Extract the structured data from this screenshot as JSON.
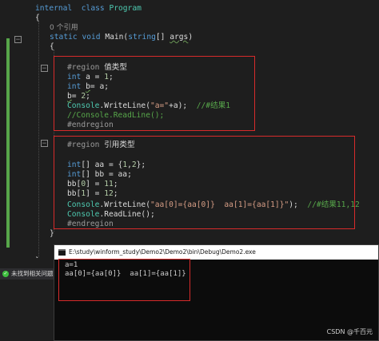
{
  "editor": {
    "lines": [
      {
        "segments": [
          [
            "kw",
            "internal"
          ],
          [
            "",
            "  "
          ],
          [
            "kw",
            "class"
          ],
          [
            "",
            ""
          ],
          [
            "ty",
            " Program"
          ]
        ]
      },
      {
        "segments": [
          [
            "",
            "{"
          ]
        ]
      },
      {
        "segments": [
          [
            "ref",
            "0 个引用"
          ]
        ]
      },
      {
        "segments": [
          [
            "kw",
            "static"
          ],
          [
            "",
            " "
          ],
          [
            "kw",
            "void"
          ],
          [
            "",
            " "
          ],
          [
            "",
            "Main("
          ],
          [
            "kw",
            "string"
          ],
          [
            "",
            "[] "
          ],
          [
            "sq",
            "args"
          ],
          [
            "",
            ")"
          ]
        ]
      },
      {
        "segments": [
          [
            "",
            "{"
          ]
        ]
      },
      {
        "segments": [
          [
            "pp",
            "#region "
          ],
          [
            "zh",
            "值类型"
          ]
        ]
      },
      {
        "segments": [
          [
            "kw",
            "int"
          ],
          [
            "",
            " a = "
          ],
          [
            "num",
            "1"
          ],
          [
            "",
            ";"
          ]
        ]
      },
      {
        "segments": [
          [
            "kw",
            "int"
          ],
          [
            "",
            " "
          ],
          [
            "sq",
            "b"
          ],
          [
            "",
            "= a;"
          ]
        ]
      },
      {
        "segments": [
          [
            "sq",
            "b"
          ],
          [
            "",
            "= "
          ],
          [
            "num",
            "2"
          ],
          [
            "",
            ";"
          ]
        ]
      },
      {
        "segments": [
          [
            "ty",
            "Console"
          ],
          [
            "",
            ".WriteLine("
          ],
          [
            "str",
            "\"a=\""
          ],
          [
            "",
            "+a);  "
          ],
          [
            "cm",
            "//#结果1"
          ]
        ]
      },
      {
        "segments": [
          [
            "cm",
            "//Console.ReadLine();"
          ]
        ]
      },
      {
        "segments": [
          [
            "pp",
            "#endregion"
          ]
        ]
      },
      {
        "segments": [
          [
            "pp",
            "#region "
          ],
          [
            "zh",
            "引用类型"
          ]
        ]
      },
      {
        "segments": [
          [
            "kw",
            "int"
          ],
          [
            "",
            "[] aa = {"
          ],
          [
            "num",
            "1"
          ],
          [
            "",
            ","
          ],
          [
            "num",
            "2"
          ],
          [
            "",
            "};"
          ]
        ]
      },
      {
        "segments": [
          [
            "kw",
            "int"
          ],
          [
            "",
            "[] bb = aa;"
          ]
        ]
      },
      {
        "segments": [
          [
            "",
            "bb["
          ],
          [
            "num",
            "0"
          ],
          [
            "",
            "] = "
          ],
          [
            "num",
            "11"
          ],
          [
            "",
            ";"
          ]
        ]
      },
      {
        "segments": [
          [
            "",
            "bb["
          ],
          [
            "num",
            "1"
          ],
          [
            "",
            "] = "
          ],
          [
            "num",
            "12"
          ],
          [
            "",
            ";"
          ]
        ]
      },
      {
        "segments": [
          [
            "ty",
            "Console"
          ],
          [
            "",
            ".WriteLine("
          ],
          [
            "str",
            "\"aa[0]={aa[0]}  aa[1]={aa[1]}\""
          ],
          [
            "",
            ");  "
          ],
          [
            "cm",
            "//#结果11,12"
          ]
        ]
      },
      {
        "segments": [
          [
            "ty",
            "Console"
          ],
          [
            "",
            ".ReadLine();"
          ]
        ]
      },
      {
        "segments": [
          [
            "pp",
            "#endregion"
          ]
        ]
      },
      {
        "segments": [
          [
            "",
            "}"
          ]
        ]
      },
      {
        "segments": [
          [
            "",
            "}"
          ]
        ]
      }
    ]
  },
  "status": {
    "text": "未找到相关问题"
  },
  "console": {
    "title": "E:\\study\\winform_study\\Demo2\\Demo2\\bin\\Debug\\Demo2.exe",
    "output": [
      "a=1",
      "aa[0]={aa[0]}  aa[1]={aa[1]}"
    ]
  },
  "watermark": "CSDN @千百元",
  "colors": {
    "keyword": "#569cd6",
    "type": "#4ec9b0",
    "number": "#b5cea8",
    "string": "#d69d85",
    "comment": "#57a64a",
    "highlight_box": "#d72b2b"
  }
}
